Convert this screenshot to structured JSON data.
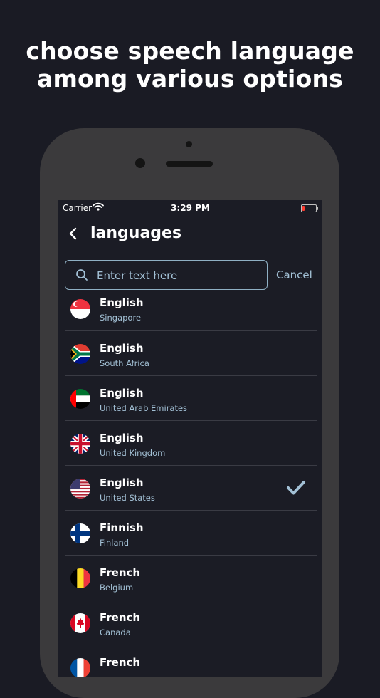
{
  "headline": {
    "line1": "choose speech language",
    "line2": "among various options"
  },
  "status": {
    "carrier": "Carrier",
    "time": "3:29 PM"
  },
  "nav": {
    "title": "languages"
  },
  "search": {
    "placeholder": "Enter text here",
    "value": "",
    "cancel_label": "Cancel"
  },
  "languages": [
    {
      "name": "English",
      "region": "Singapore",
      "flag": "singapore-flag-icon"
    },
    {
      "name": "English",
      "region": "South Africa",
      "flag": "south-africa-flag-icon"
    },
    {
      "name": "English",
      "region": "United Arab Emirates",
      "flag": "uae-flag-icon"
    },
    {
      "name": "English",
      "region": "United Kingdom",
      "flag": "uk-flag-icon"
    },
    {
      "name": "English",
      "region": "United States",
      "flag": "us-flag-icon",
      "selected": true
    },
    {
      "name": "Finnish",
      "region": "Finland",
      "flag": "finland-flag-icon"
    },
    {
      "name": "French",
      "region": "Belgium",
      "flag": "belgium-flag-icon"
    },
    {
      "name": "French",
      "region": "Canada",
      "flag": "canada-flag-icon"
    },
    {
      "name": "French",
      "region": "",
      "flag": "france-flag-icon"
    }
  ],
  "colors": {
    "background": "#1a1b24",
    "accent": "#a3c1d6",
    "battery_low": "#ff3b30"
  }
}
